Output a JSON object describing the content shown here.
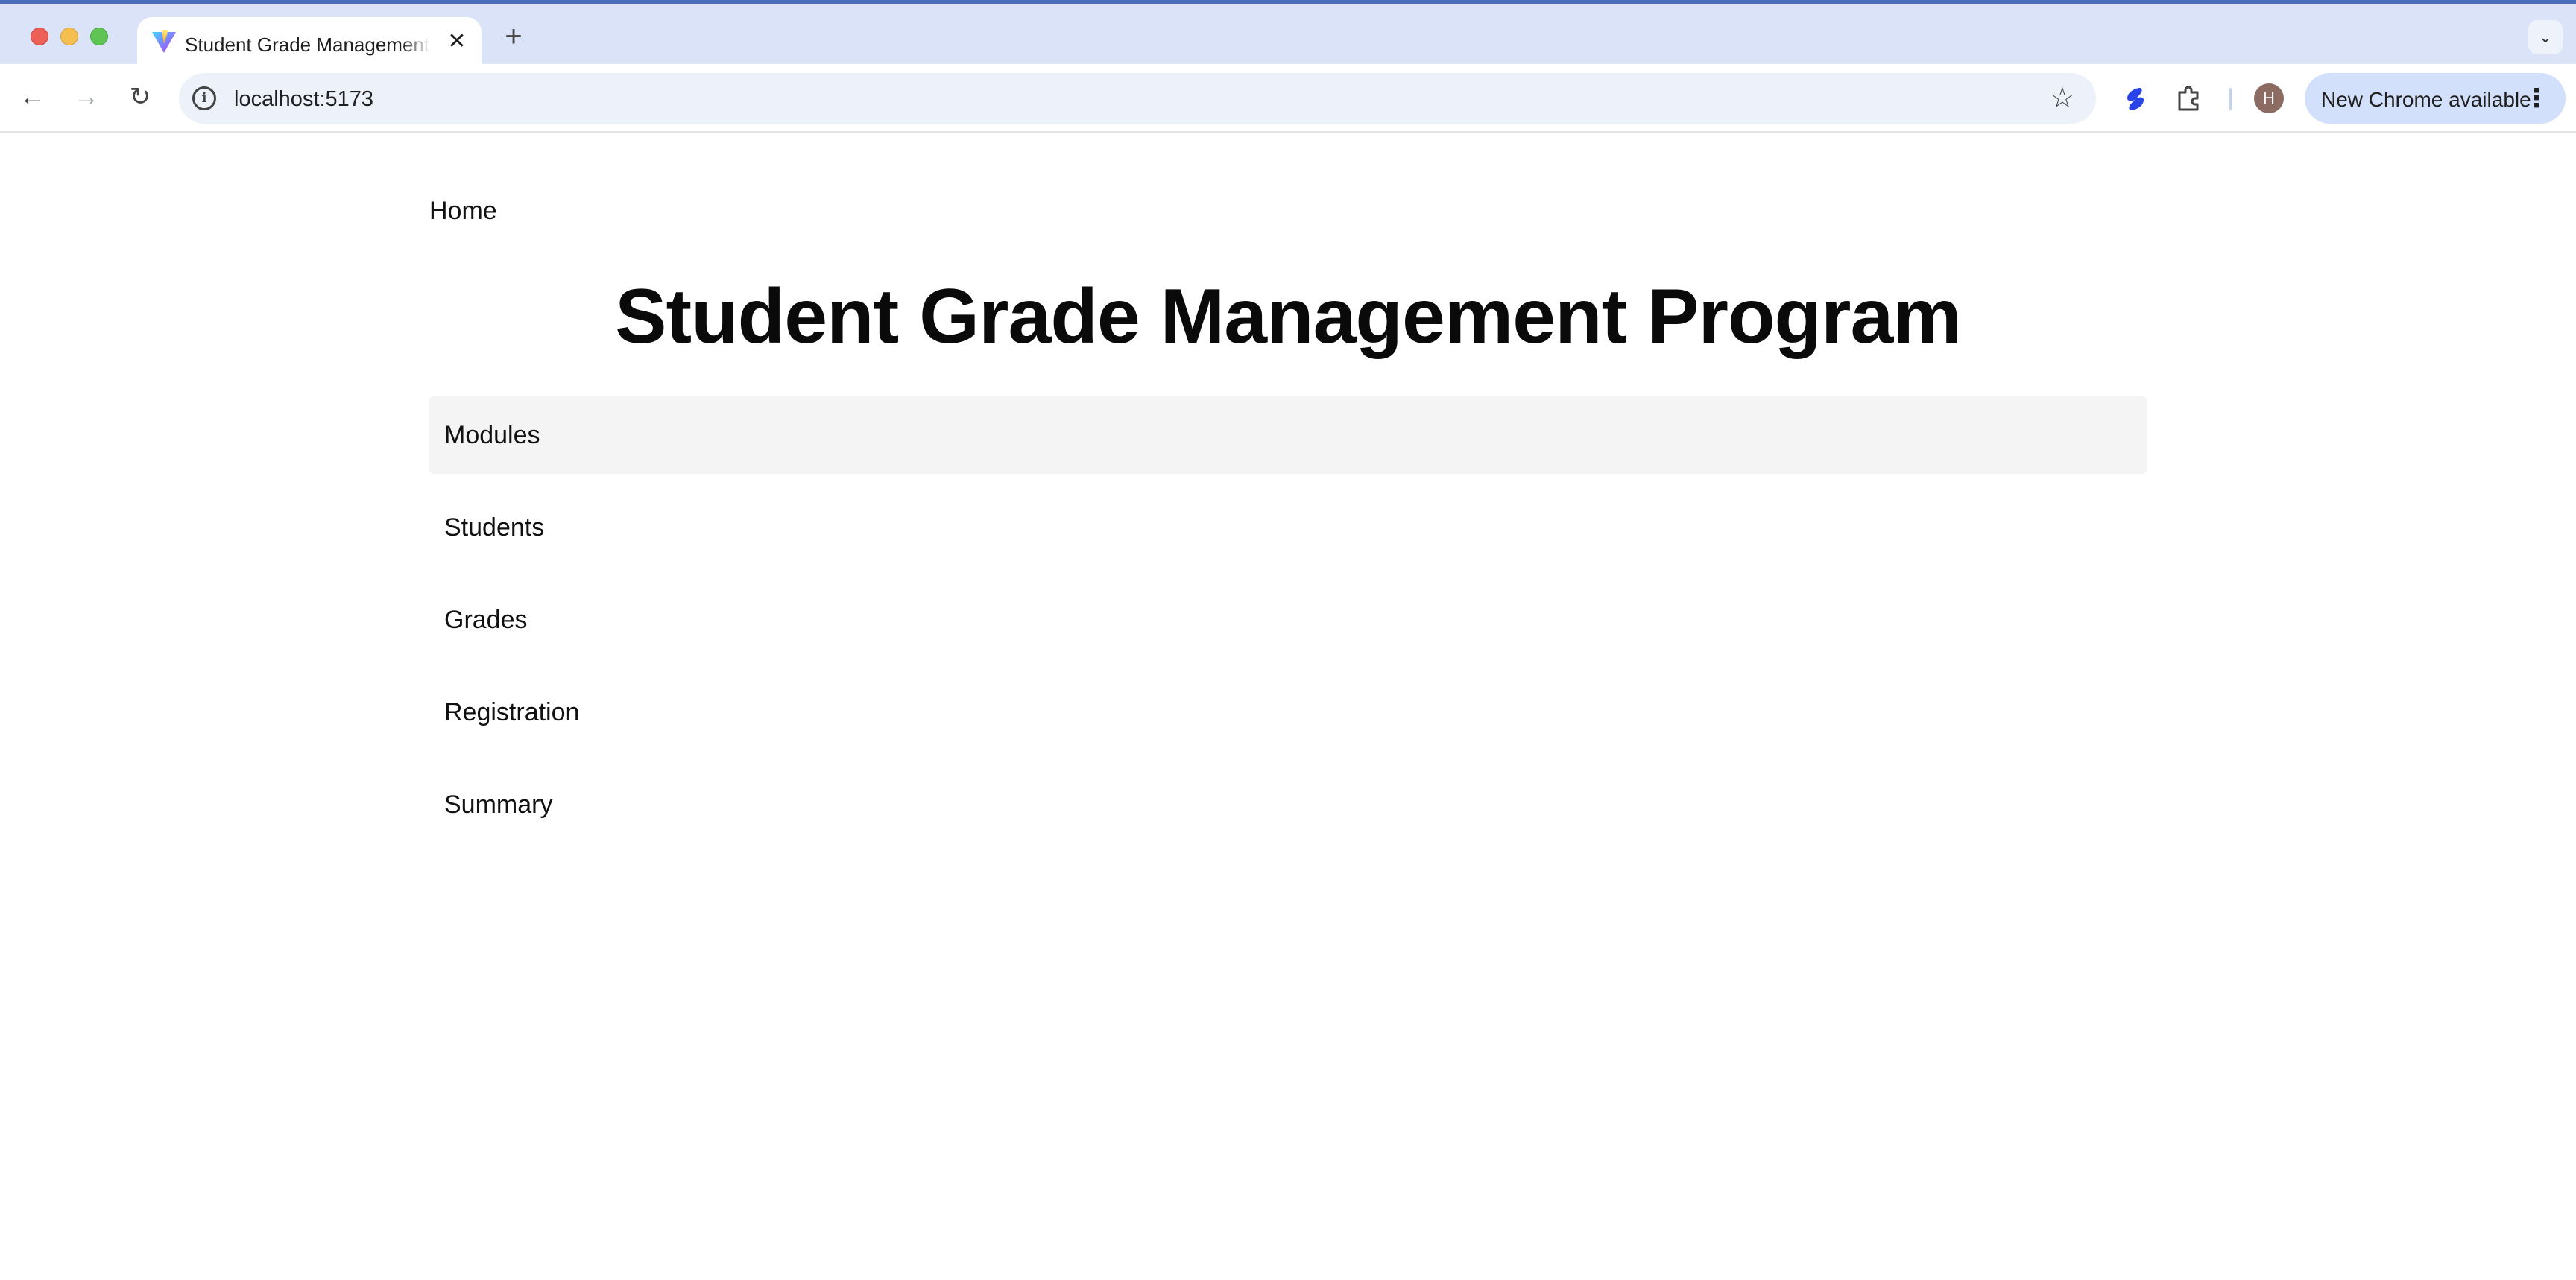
{
  "browser": {
    "tab": {
      "title": "Student Grade Management System",
      "favicon": "vite-logo-icon"
    },
    "address_bar": {
      "url": "localhost:5173"
    },
    "toolbar": {
      "profile_initial": "H",
      "update_label": "New Chrome available"
    },
    "colors": {
      "titlebar": "#dbe3f8",
      "update_pill": "#d3e0fb",
      "active_item": "#f4f4f4"
    }
  },
  "page": {
    "breadcrumb": "Home",
    "title": "Student Grade Management Program",
    "menu": [
      {
        "label": "Modules",
        "active": true
      },
      {
        "label": "Students",
        "active": false
      },
      {
        "label": "Grades",
        "active": false
      },
      {
        "label": "Registration",
        "active": false
      },
      {
        "label": "Summary",
        "active": false
      }
    ]
  }
}
